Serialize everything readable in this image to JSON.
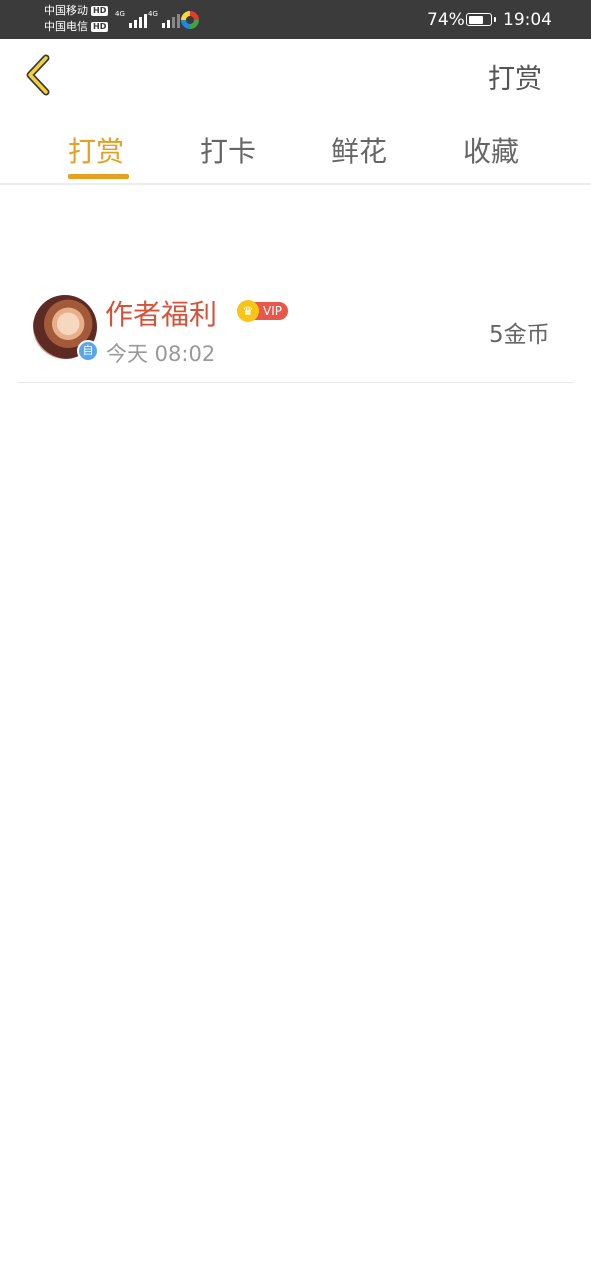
{
  "status_bar": {
    "carrier_1": "中国移动",
    "carrier_2": "中国电信",
    "hd_badge": "HD",
    "network_1": "4G",
    "network_2": "4G",
    "battery_level": "74%",
    "battery_fraction": 0.74,
    "time": "19:04"
  },
  "header": {
    "back_icon": "chevron-left-icon",
    "title": "打赏"
  },
  "tabs": [
    {
      "label": "打赏",
      "active": true
    },
    {
      "label": "打卡",
      "active": false
    },
    {
      "label": "鲜花",
      "active": false
    },
    {
      "label": "收藏",
      "active": false
    }
  ],
  "records": [
    {
      "name": "作者福利",
      "vip_label": "VIP",
      "avatar_badge": "自",
      "time": "今天 08:02",
      "amount": "5金币"
    }
  ],
  "colors": {
    "accent": "#e6a020",
    "name": "#d4533b",
    "vip": "#e8574a"
  }
}
